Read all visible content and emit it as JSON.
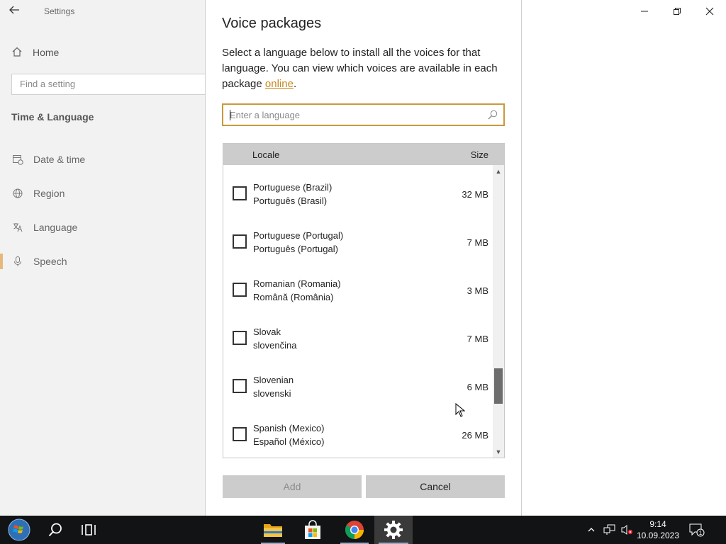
{
  "settings_window": {
    "app_title": "Settings",
    "home_label": "Home",
    "search_placeholder": "Find a setting",
    "section_title": "Time & Language",
    "nav_items": [
      {
        "label": "Date & time",
        "icon": "calendar-clock-icon",
        "active": false
      },
      {
        "label": "Region",
        "icon": "globe-icon",
        "active": false
      },
      {
        "label": "Language",
        "icon": "language-icon",
        "active": false
      },
      {
        "label": "Speech",
        "icon": "microphone-icon",
        "active": true
      }
    ]
  },
  "dialog": {
    "title": "Voice packages",
    "description_text": "Select a language below to install all the voices for that language. You can view which voices are available in each package ",
    "description_link": "online",
    "description_end": ".",
    "search_placeholder": "Enter a language",
    "columns": {
      "locale": "Locale",
      "size": "Size"
    },
    "rows": [
      {
        "name": "Portuguese (Brazil)",
        "native": "Português (Brasil)",
        "size": "32 MB",
        "checked": false
      },
      {
        "name": "Portuguese (Portugal)",
        "native": "Português (Portugal)",
        "size": "7 MB",
        "checked": false
      },
      {
        "name": "Romanian (Romania)",
        "native": "Română (România)",
        "size": "3 MB",
        "checked": false
      },
      {
        "name": "Slovak",
        "native": "slovenčina",
        "size": "7 MB",
        "checked": false
      },
      {
        "name": "Slovenian",
        "native": "slovenski",
        "size": "6 MB",
        "checked": false
      },
      {
        "name": "Spanish (Mexico)",
        "native": "Español (México)",
        "size": "26 MB",
        "checked": false
      }
    ],
    "scroll_position": 0.82,
    "add_label": "Add",
    "cancel_label": "Cancel"
  },
  "taskbar": {
    "time": "9:14",
    "date": "10.09.2023",
    "notification_count": "1",
    "pinned": [
      "start-icon",
      "search-icon",
      "task-view-icon",
      "file-explorer-icon",
      "microsoft-store-icon",
      "chrome-icon",
      "settings-gear-icon"
    ]
  },
  "colors": {
    "accent": "#c99a3a",
    "link": "#c8861b",
    "active_nav_marker": "#e8b87a",
    "taskbar": "#111315"
  }
}
